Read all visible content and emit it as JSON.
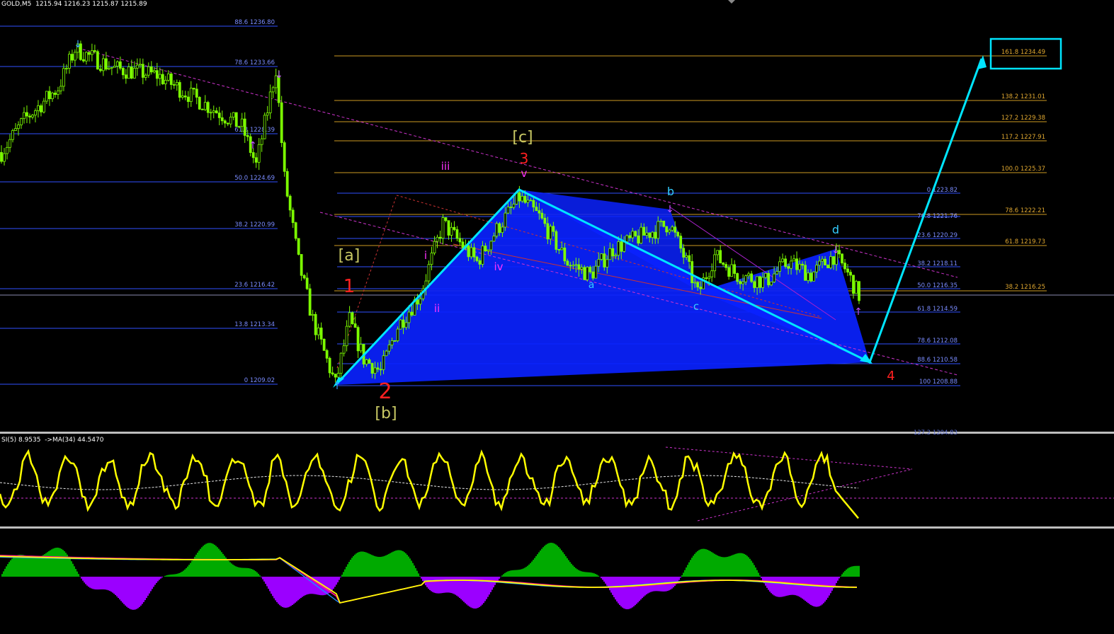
{
  "header": {
    "symbol": "GOLD,M5",
    "ohlc": "1215.94 1216.23 1215.87 1215.89"
  },
  "rsi_header": "SI(5) 8.9535  ->MA(34) 44.5470",
  "colors": {
    "background": "#000000",
    "candle": "#7cfc00",
    "pattern_fill": "#0000ff",
    "projection": "#00e5ff",
    "fib_left": "#3050ff",
    "fib_right": "#cc9a22",
    "trend": "#cc33cc",
    "rsi": "#ffff00",
    "hist_up": "#00aa00",
    "hist_down": "#9b00ff",
    "wave_red": "#ff2020",
    "wave_olive": "#c8c864",
    "wave_magenta": "#ff33ff",
    "wave_cyan": "#33ccff"
  },
  "fib_left": [
    {
      "label": "88.6 1236.80"
    },
    {
      "label": "78.6 1233.66"
    },
    {
      "label": "61.8 1228.39"
    },
    {
      "label": "50.0 1224.69"
    },
    {
      "label": "38.2 1220.99"
    },
    {
      "label": "23.6 1216.42"
    },
    {
      "label": "13.8 1213.34"
    },
    {
      "label": "0 1209.02"
    }
  ],
  "fib_right_gold": [
    {
      "label": "161.8 1234.49"
    },
    {
      "label": "138.2 1231.01"
    },
    {
      "label": "127.2 1229.38"
    },
    {
      "label": "117.2 1227.91"
    },
    {
      "label": "100.0  1225.37"
    },
    {
      "label": "78.6 1222.21"
    },
    {
      "label": "61.8 1219.73"
    },
    {
      "label": "38.2 1216.25"
    }
  ],
  "fib_right_blue": [
    {
      "label": "0 1223.82"
    },
    {
      "label": "76.8 1221.76"
    },
    {
      "label": "23.6 1220.29"
    },
    {
      "label": "38.2 1218.11"
    },
    {
      "label": "50.0 1216.35"
    },
    {
      "label": "61.8 1214.59"
    },
    {
      "label": "78.6 1212.08"
    },
    {
      "label": "88.6 1210.58"
    },
    {
      "label": "100 1208.88"
    },
    {
      "label": "127.2 1204.83"
    }
  ],
  "wave_labels": [
    {
      "text": "[c]"
    },
    {
      "text": "3"
    },
    {
      "text": "iii"
    },
    {
      "text": "v"
    },
    {
      "text": "[a]"
    },
    {
      "text": "1"
    },
    {
      "text": "i"
    },
    {
      "text": "ii"
    },
    {
      "text": "iv"
    },
    {
      "text": "2"
    },
    {
      "text": "[b]"
    },
    {
      "text": "a"
    },
    {
      "text": "b"
    },
    {
      "text": "c"
    },
    {
      "text": "d"
    },
    {
      "text": "4"
    }
  ],
  "chart_data": {
    "type": "line",
    "symbol": "GOLD",
    "timeframe": "M5",
    "open": 1215.94,
    "high": 1216.23,
    "low": 1215.87,
    "close": 1215.89,
    "price_path": [
      {
        "bar": 0,
        "price": 1227.0
      },
      {
        "bar": 8,
        "price": 1229.5
      },
      {
        "bar": 20,
        "price": 1232.0
      },
      {
        "bar": 26,
        "price": 1235.0
      },
      {
        "bar": 40,
        "price": 1233.5
      },
      {
        "bar": 55,
        "price": 1233.0
      },
      {
        "bar": 70,
        "price": 1231.0
      },
      {
        "bar": 85,
        "price": 1229.0
      },
      {
        "bar": 90,
        "price": 1226.0
      },
      {
        "bar": 97,
        "price": 1233.5
      },
      {
        "bar": 100,
        "price": 1225.0
      },
      {
        "bar": 105,
        "price": 1218.5
      },
      {
        "bar": 110,
        "price": 1214.0
      },
      {
        "bar": 118,
        "price": 1209.0
      },
      {
        "bar": 123,
        "price": 1214.0
      },
      {
        "bar": 128,
        "price": 1211.0
      },
      {
        "bar": 134,
        "price": 1210.0
      },
      {
        "bar": 140,
        "price": 1213.5
      },
      {
        "bar": 148,
        "price": 1216.0
      },
      {
        "bar": 156,
        "price": 1221.5
      },
      {
        "bar": 162,
        "price": 1220.0
      },
      {
        "bar": 168,
        "price": 1218.5
      },
      {
        "bar": 175,
        "price": 1221.0
      },
      {
        "bar": 183,
        "price": 1223.5
      },
      {
        "bar": 190,
        "price": 1222.0
      },
      {
        "bar": 200,
        "price": 1218.5
      },
      {
        "bar": 208,
        "price": 1217.5
      },
      {
        "bar": 216,
        "price": 1219.5
      },
      {
        "bar": 226,
        "price": 1220.5
      },
      {
        "bar": 236,
        "price": 1221.5
      },
      {
        "bar": 242,
        "price": 1218.5
      },
      {
        "bar": 246,
        "price": 1216.0
      },
      {
        "bar": 252,
        "price": 1219.0
      },
      {
        "bar": 260,
        "price": 1217.5
      },
      {
        "bar": 270,
        "price": 1217.0
      },
      {
        "bar": 278,
        "price": 1218.5
      },
      {
        "bar": 286,
        "price": 1217.5
      },
      {
        "bar": 294,
        "price": 1219.0
      },
      {
        "bar": 298,
        "price": 1218.0
      },
      {
        "bar": 303,
        "price": 1215.9
      }
    ],
    "rsi_value": 8.9535,
    "rsi_ma_value": 44.547
  }
}
